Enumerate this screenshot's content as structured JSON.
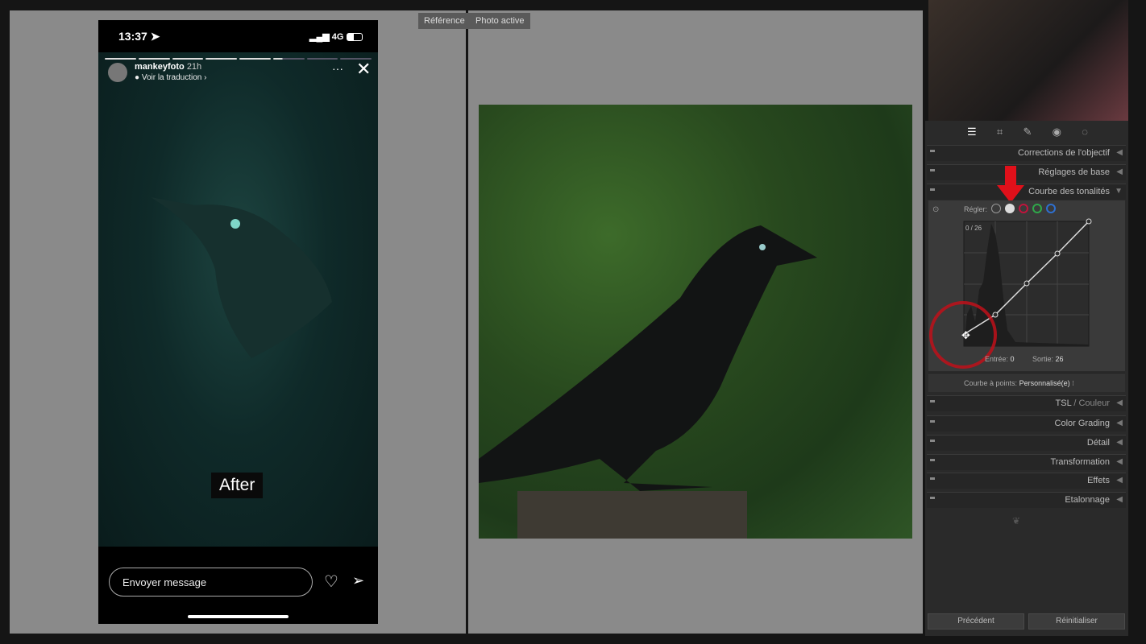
{
  "labels": {
    "reference": "Référence",
    "active": "Photo active"
  },
  "phone": {
    "time": "13:37",
    "network": "4G",
    "username": "mankeyfoto",
    "age": "21h",
    "translate": "Voir la traduction",
    "overlay": "After",
    "message_placeholder": "Envoyer message",
    "progress_segments": 8,
    "progress_filled": 5.3
  },
  "panel": {
    "tools": [
      "sliders-icon",
      "crop-icon",
      "heal-icon",
      "redeye-icon",
      "mask-icon"
    ],
    "sections_top": [
      {
        "label": "Corrections de l'objectif"
      },
      {
        "label": "Réglages de base"
      },
      {
        "label": "Courbe des tonalités",
        "expanded": true
      }
    ],
    "curve": {
      "adjust_label": "Régler:",
      "readout": "0 / 26",
      "input_label": "Entrée:",
      "input_value": "0",
      "output_label": "Sortie:",
      "output_value": "26",
      "point_curve_label": "Courbe à points:",
      "point_curve_value": "Personnalisé(e)",
      "channels": [
        {
          "name": "parametric"
        },
        {
          "name": "rgb",
          "color": "#dddddd"
        },
        {
          "name": "red",
          "color": "#c0143c"
        },
        {
          "name": "green",
          "color": "#2fa84a"
        },
        {
          "name": "blue",
          "color": "#2e6fd0"
        }
      ]
    },
    "sections_bottom": [
      {
        "label": "TSL",
        "label2": "Couleur"
      },
      {
        "label": "Color Grading"
      },
      {
        "label": "Détail"
      },
      {
        "label": "Transformation"
      },
      {
        "label": "Effets"
      },
      {
        "label": "Etalonnage"
      }
    ],
    "prev": "Précédent",
    "reset": "Réinitialiser"
  },
  "colors": {
    "annotation": "#e0101a"
  }
}
